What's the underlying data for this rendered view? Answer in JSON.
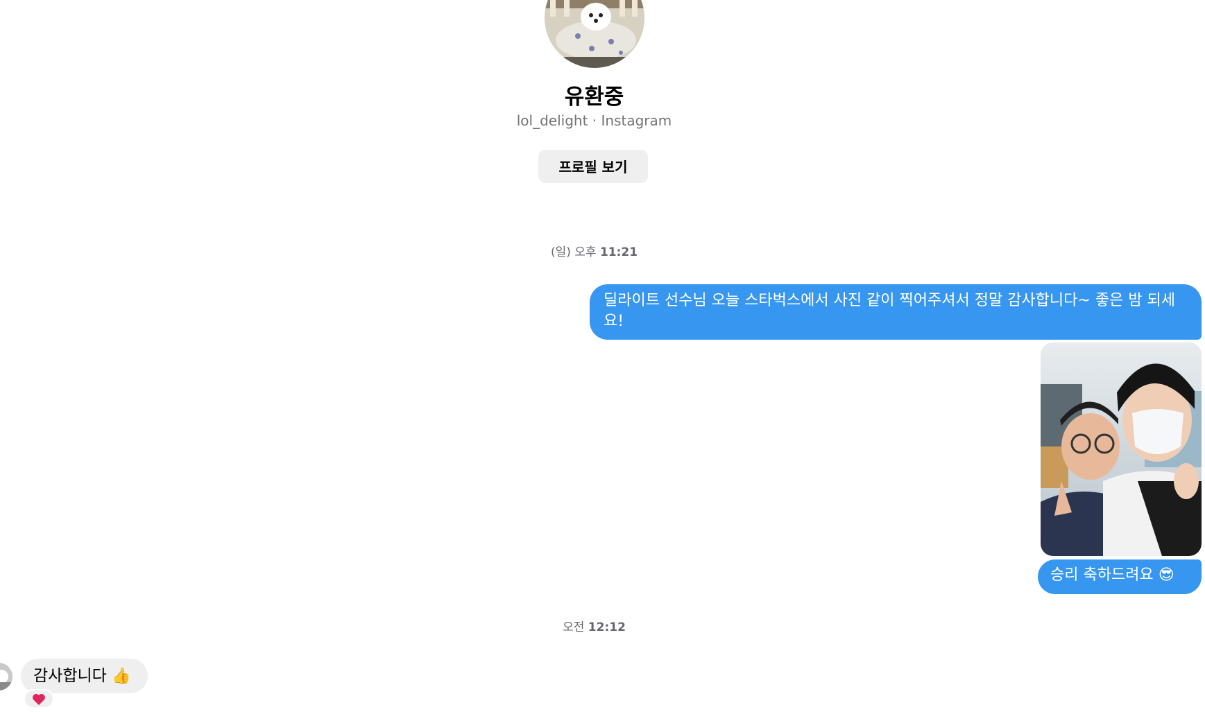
{
  "profile": {
    "name": "유환중",
    "subtitle": "lol_delight · Instagram",
    "view_profile_label": "프로필 보기"
  },
  "messages": [
    {
      "type": "timestamp",
      "prefix": "(일) 오후",
      "time": "11:21"
    },
    {
      "type": "text",
      "direction": "outgoing",
      "text": "딜라이트 선수님 오늘 스타벅스에서 사진 같이 찍어주셔서 정말 감사합니다~ 좋은 밤 되세요!"
    },
    {
      "type": "photo",
      "direction": "outgoing"
    },
    {
      "type": "text",
      "direction": "outgoing",
      "text": "승리 축하드려요",
      "emoji": "😎"
    },
    {
      "type": "timestamp",
      "prefix": "오전",
      "time": "12:12"
    },
    {
      "type": "text",
      "direction": "incoming",
      "text": "감사합니다",
      "emoji": "👍",
      "reaction": "heart-icon"
    }
  ],
  "colors": {
    "outgoing_bubble": "#3797f0",
    "incoming_bubble": "#efefef",
    "reaction_heart": "#e0245e",
    "secondary_text": "#737373"
  }
}
